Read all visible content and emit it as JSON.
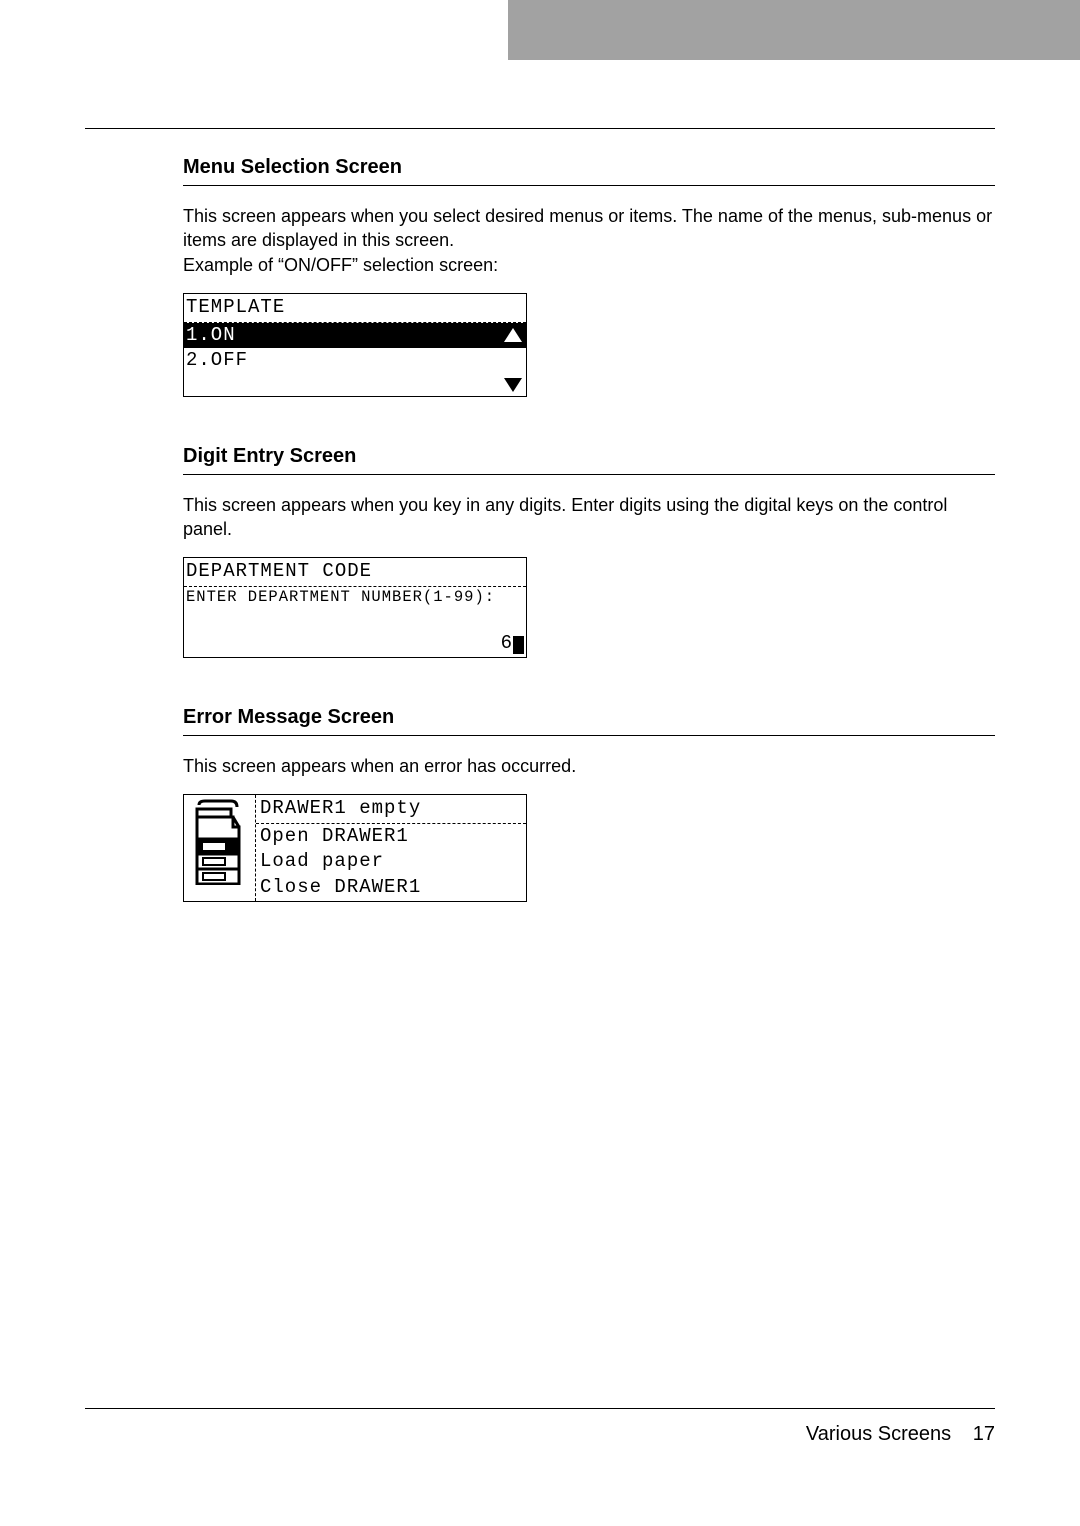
{
  "sections": {
    "menu": {
      "title": "Menu Selection Screen",
      "body1": "This screen appears when you select desired menus or items. The name of the menus, sub-menus or items are displayed in this screen.",
      "body2": "Example of “ON/OFF” selection screen:",
      "lcd": {
        "header": "TEMPLATE",
        "row1": "1.ON",
        "row2": "2.OFF"
      }
    },
    "digit": {
      "title": "Digit Entry Screen",
      "body1": "This screen appears when you key in any digits. Enter digits using the digital keys on the control panel.",
      "lcd": {
        "header": "DEPARTMENT CODE",
        "prompt": "ENTER DEPARTMENT NUMBER(1-99):",
        "value": "6"
      }
    },
    "error": {
      "title": "Error Message Screen",
      "body1": "This screen appears when an error has occurred.",
      "lcd": {
        "header": "DRAWER1 empty",
        "line1": "Open DRAWER1",
        "line2": "Load paper",
        "line3": "Close DRAWER1"
      }
    }
  },
  "footer": {
    "label": "Various Screens",
    "page": "17"
  }
}
